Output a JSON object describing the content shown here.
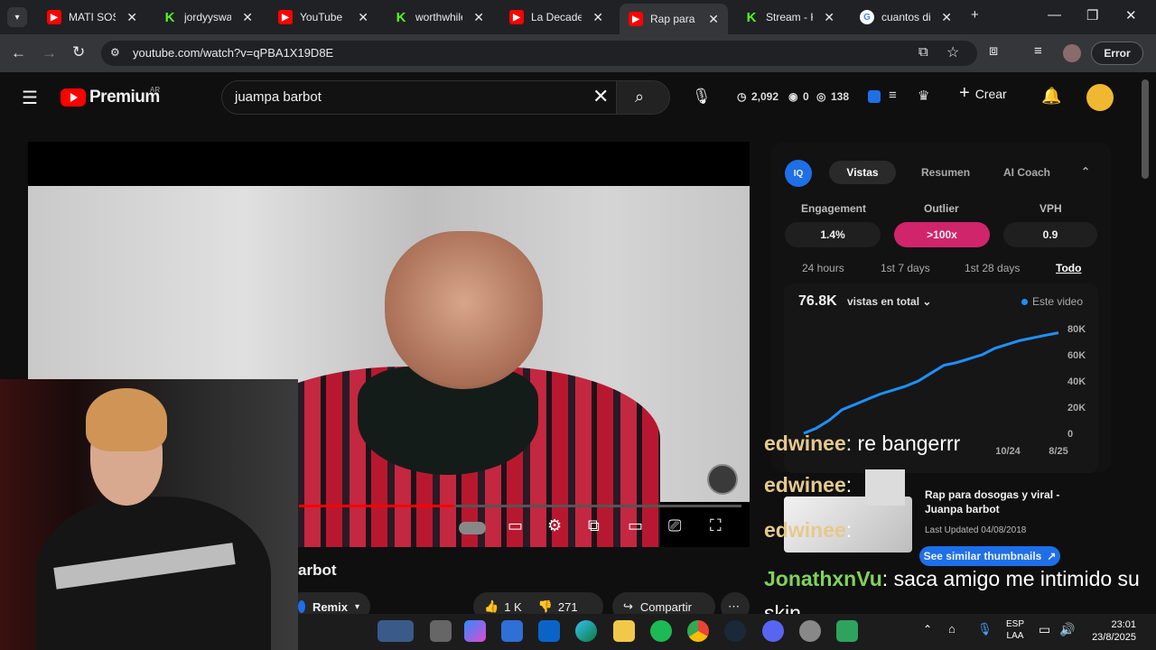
{
  "tabs": [
    {
      "label": "MATI SOSTE",
      "type": "yt"
    },
    {
      "label": "jordyyswag",
      "type": "kick"
    },
    {
      "label": "YouTube",
      "type": "yt"
    },
    {
      "label": "worthwhilein",
      "type": "kick"
    },
    {
      "label": "La Decadenc",
      "type": "yt"
    },
    {
      "label": "Rap para do",
      "type": "yt"
    },
    {
      "label": "Stream - Kic",
      "type": "kick"
    },
    {
      "label": "cuantos dias",
      "type": "g"
    }
  ],
  "browser": {
    "url": "youtube.com/watch?v=qPBA1X19D8E",
    "error_label": "Error"
  },
  "youtube": {
    "logo_text": "Premium",
    "region": "AR",
    "search_value": "juampa barbot",
    "stats": {
      "count1": "2,092",
      "count2": "0",
      "count3": "138"
    },
    "create_label": "Crear",
    "video_title_fragment": "arbot",
    "remix_label": "Remix",
    "likes": "1 K",
    "dislikes": "271",
    "share_label": "Compartir"
  },
  "panel": {
    "logo": "IQ",
    "tabs": [
      "Vistas",
      "Resumen",
      "AI Coach"
    ],
    "metrics": [
      {
        "label": "Engagement",
        "value": "1.4%"
      },
      {
        "label": "Outlier",
        "value": ">100x"
      },
      {
        "label": "VPH",
        "value": "0.9"
      }
    ],
    "periods": [
      "24 hours",
      "1st 7 days",
      "1st 28 days",
      "Todo"
    ],
    "views_total": "76.8K",
    "views_dropdown": "vistas en total",
    "legend": "Este video",
    "card_title": "Rap para dosogas y viral - Juanpa barbot",
    "card_updated": "Last Updated 04/08/2018",
    "similar_btn": "See similar thumbnails"
  },
  "chart_data": {
    "type": "line",
    "x_ticks": [
      "10/24",
      "8/25"
    ],
    "y_ticks": [
      "0",
      "20K",
      "40K",
      "60K",
      "80K"
    ],
    "ylim": [
      0,
      80000
    ],
    "series": [
      {
        "name": "Este video",
        "values": [
          0,
          4000,
          10000,
          18000,
          22000,
          26000,
          30000,
          33000,
          36000,
          40000,
          46000,
          52000,
          54000,
          57000,
          60000,
          65000,
          68000,
          71000,
          73000,
          75000,
          76800
        ]
      }
    ],
    "color": "#1e90ff"
  },
  "chat": [
    {
      "user": "edwinee",
      "text": "re bangerrr",
      "color": "#e6c98c"
    },
    {
      "user": "edwinee",
      "text": "",
      "color": "#e6c98c"
    },
    {
      "user": "edwinee",
      "text": "",
      "color": "#e6c98c"
    },
    {
      "user": "JonathxnVu",
      "text": "saca amigo me intimido su skin",
      "color": "#7fd35a"
    }
  ],
  "tray": {
    "lang1": "ESP",
    "lang2": "LAA",
    "time": "23:01",
    "date": "23/8/2025"
  }
}
